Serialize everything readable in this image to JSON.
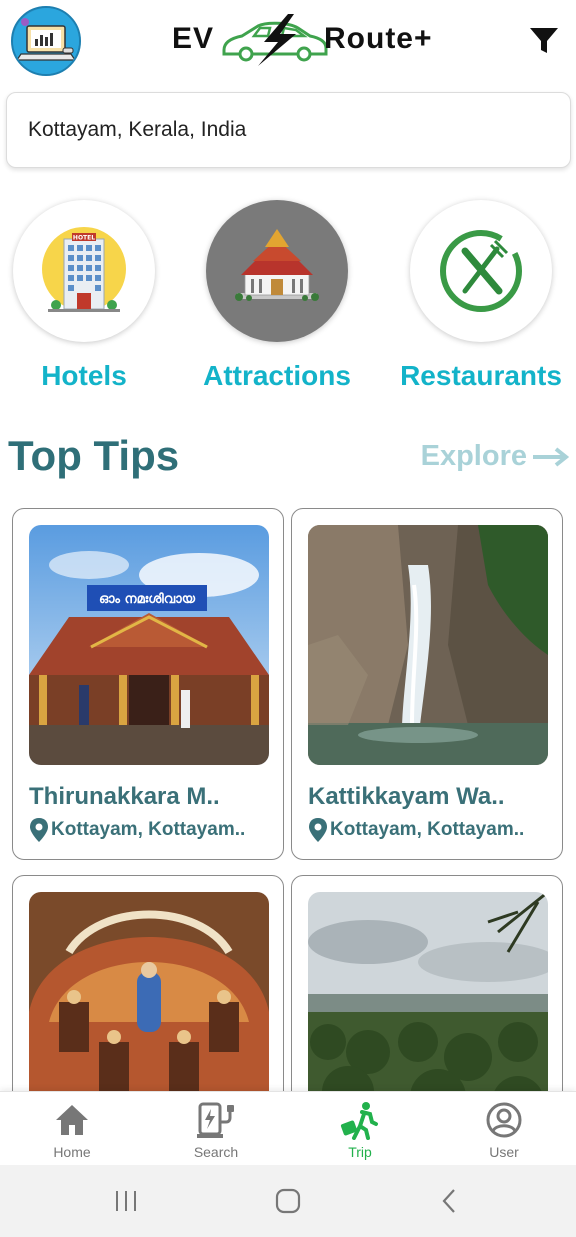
{
  "header": {
    "logo_left": "EV",
    "logo_right": "Route+",
    "brand_colors": {
      "car": "#3fa34d",
      "bolt": "#111111"
    }
  },
  "search": {
    "value": "Kottayam, Kerala, India"
  },
  "categories": [
    {
      "label": "Hotels",
      "icon": "hotel-building-icon"
    },
    {
      "label": "Attractions",
      "icon": "temple-icon"
    },
    {
      "label": "Restaurants",
      "icon": "fork-knife-icon"
    }
  ],
  "section": {
    "title": "Top Tips",
    "explore_label": "Explore"
  },
  "cards": [
    {
      "title": "Thirunakkara M..",
      "location": "Kottayam, Kottayam..",
      "sign": "ഓം നമഃശിവായ"
    },
    {
      "title": "Kattikkayam Wa..",
      "location": "Kottayam, Kottayam.."
    },
    {
      "title": "",
      "location": ""
    },
    {
      "title": "",
      "location": ""
    }
  ],
  "nav": [
    {
      "label": "Home",
      "icon": "home-icon"
    },
    {
      "label": "Search",
      "icon": "ev-charger-icon"
    },
    {
      "label": "Trip",
      "icon": "traveler-icon"
    },
    {
      "label": "User",
      "icon": "user-icon"
    }
  ],
  "colors": {
    "accent": "#13b3c9",
    "title": "#2f6f78",
    "active_nav": "#22b14c"
  }
}
